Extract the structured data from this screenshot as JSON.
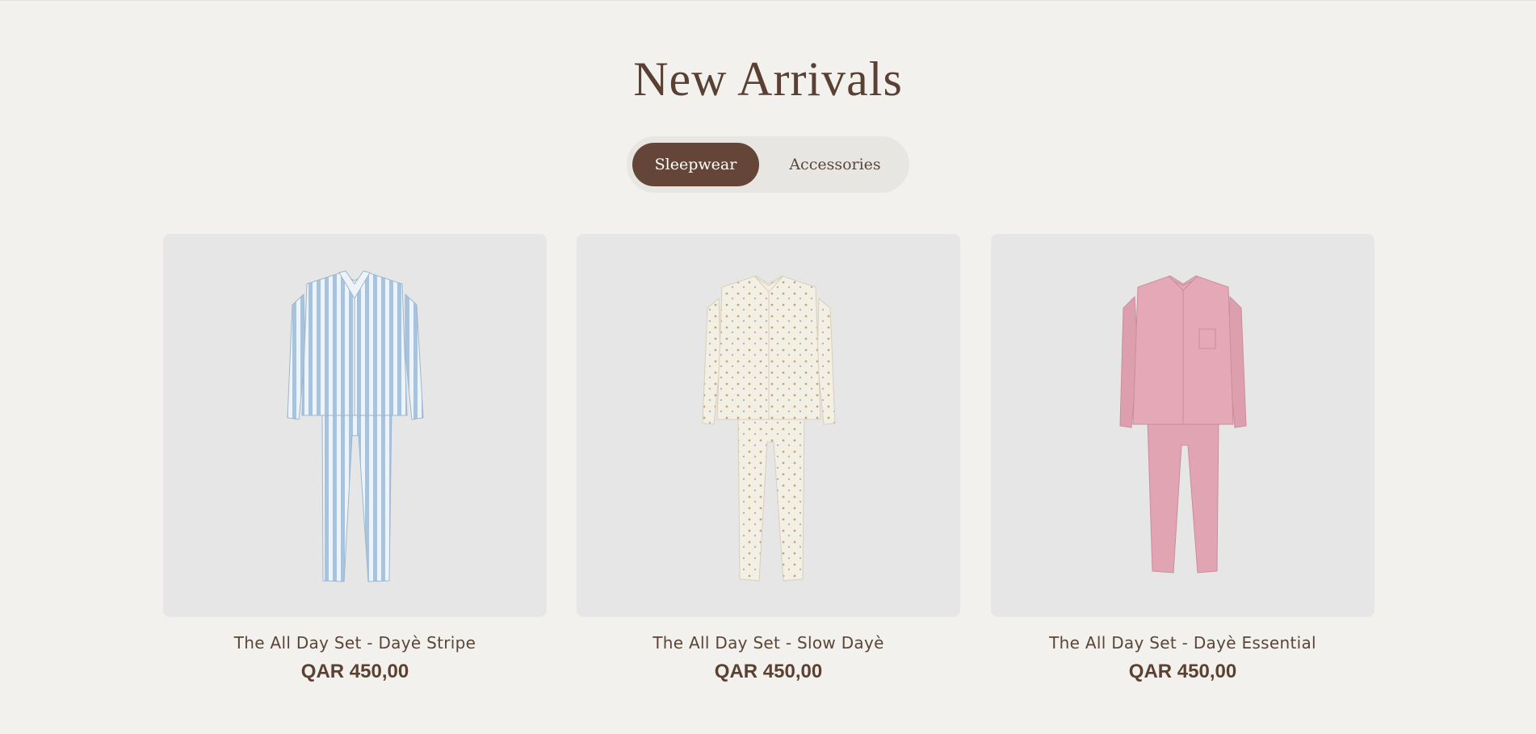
{
  "section": {
    "title": "New Arrivals"
  },
  "tabs": [
    {
      "label": "Sleepwear",
      "active": true
    },
    {
      "label": "Accessories",
      "active": false
    }
  ],
  "products": [
    {
      "title": "The All Day Set - Dayè Stripe",
      "price": "QAR 450,00",
      "image_icon": "striped-pajama-set-blue"
    },
    {
      "title": "The All Day Set - Slow Dayè",
      "price": "QAR 450,00",
      "image_icon": "printed-pajama-set-cream"
    },
    {
      "title": "The All Day Set - Dayè Essential",
      "price": "QAR 450,00",
      "image_icon": "solid-pajama-set-pink"
    }
  ],
  "colors": {
    "background": "#f2f1ed",
    "accent": "#654538",
    "card_background": "#e6e6e6"
  }
}
